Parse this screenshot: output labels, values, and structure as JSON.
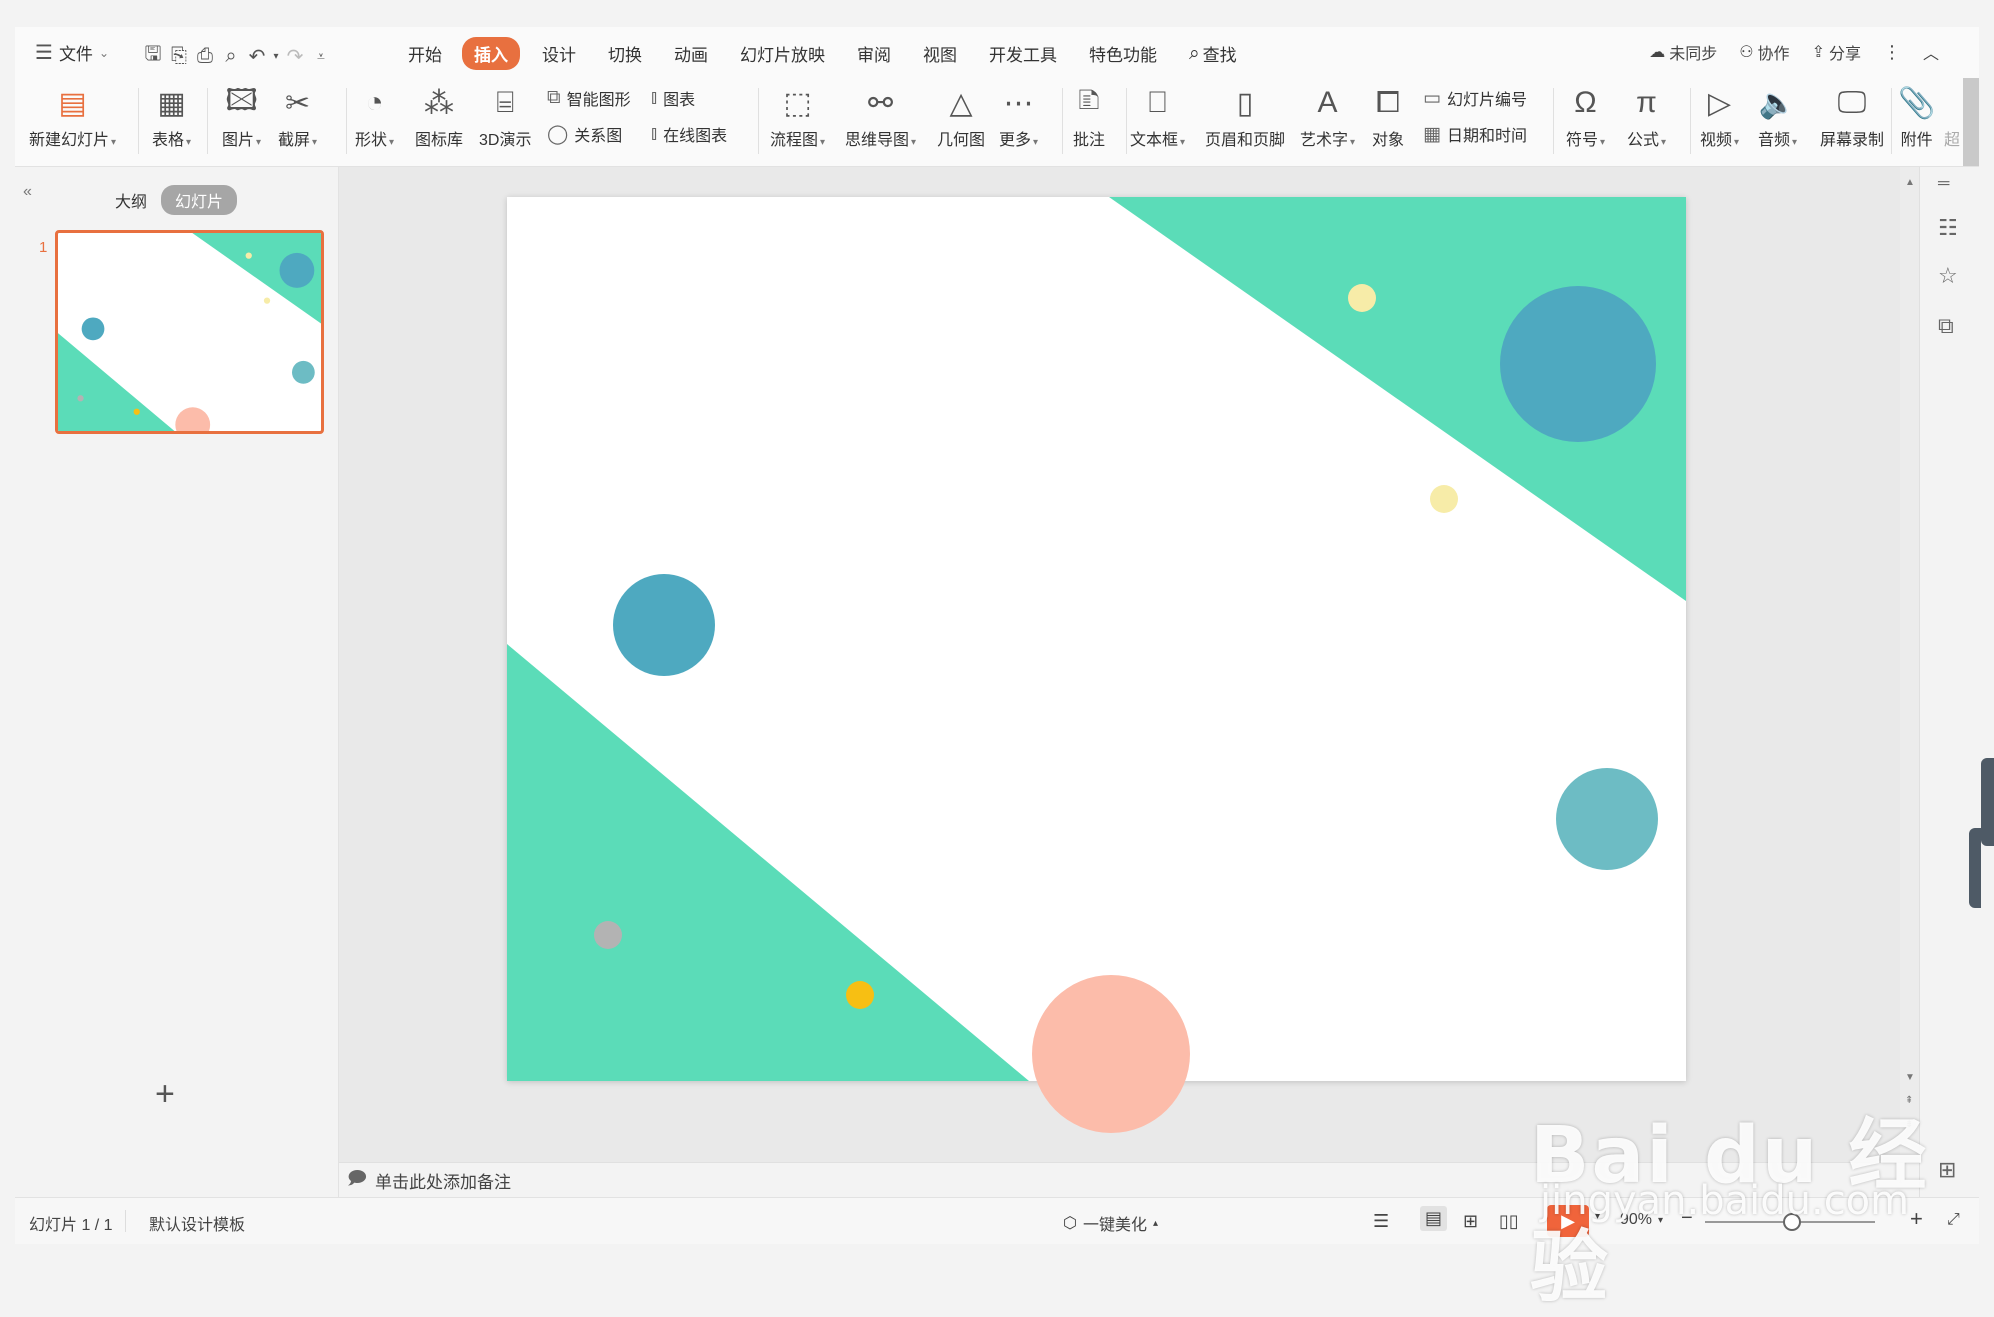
{
  "menubar": {
    "file_label": "文件",
    "tabs": [
      "开始",
      "插入",
      "设计",
      "切换",
      "动画",
      "幻灯片放映",
      "审阅",
      "视图",
      "开发工具",
      "特色功能"
    ],
    "active_tab": "插入",
    "search_label": "查找",
    "sync_label": "未同步",
    "collab_label": "协作",
    "share_label": "分享"
  },
  "ribbon": {
    "new_slide": "新建幻灯片",
    "table": "表格",
    "picture": "图片",
    "screenshot": "截屏",
    "shape": "形状",
    "icon_lib": "图标库",
    "demo3d": "3D演示",
    "smart_art": "智能图形",
    "chart": "图表",
    "relation": "关系图",
    "online_chart": "在线图表",
    "flowchart": "流程图",
    "mindmap": "思维导图",
    "geometry": "几何图",
    "more": "更多",
    "comment": "批注",
    "textbox": "文本框",
    "header_footer": "页眉和页脚",
    "wordart": "艺术字",
    "object": "对象",
    "slide_number": "幻灯片编号",
    "date_time": "日期和时间",
    "symbol": "符号",
    "formula": "公式",
    "video": "视频",
    "audio": "音频",
    "screen_record": "屏幕录制",
    "attachment": "附件",
    "hyperlink_partial": "超"
  },
  "leftpanel": {
    "outline_tab": "大纲",
    "slides_tab": "幻灯片",
    "slide_index": "1",
    "add_symbol": "+"
  },
  "notes": {
    "placeholder": "单击此处添加备注"
  },
  "statusbar": {
    "slide_count": "幻灯片 1 / 1",
    "template": "默认设计模板",
    "beautify": "一键美化",
    "zoom": "90%"
  },
  "slide": {
    "colors": {
      "teal": "#5bdcb8",
      "blue": "#4ea9c0",
      "blue_light": "#6dbcc4",
      "yellow_pale": "#f7eca8",
      "yellow": "#f7bf13",
      "gray": "#b3b3b3",
      "peach": "#fcbcaa"
    }
  },
  "watermark": {
    "main": "Bai du 经验",
    "sub": "jingyan.baidu.com"
  },
  "accent_color": "#e8703f"
}
